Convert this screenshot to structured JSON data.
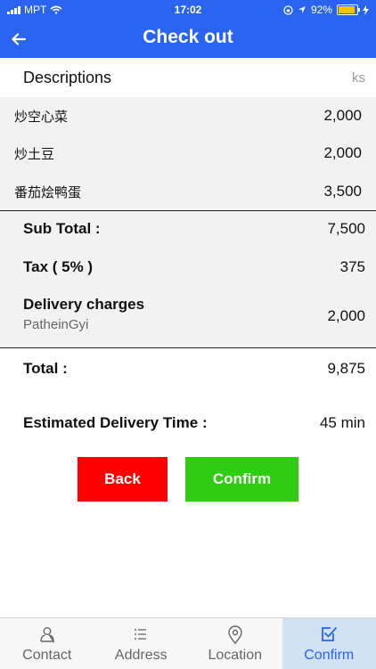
{
  "status_bar": {
    "carrier": "MPT",
    "time": "17:02",
    "battery_percent": "92%",
    "battery_level": 0.92
  },
  "header": {
    "title": "Check out",
    "back_icon": "arrow-left-icon"
  },
  "descriptions": {
    "label": "Descriptions",
    "currency": "ks"
  },
  "items": [
    {
      "name": "炒空心菜",
      "price": "2,000"
    },
    {
      "name": "炒土豆",
      "price": "2,000"
    },
    {
      "name": "番茄烩鸭蛋",
      "price": "3,500"
    }
  ],
  "summary": {
    "subtotal_label": "Sub Total :",
    "subtotal_value": "7,500",
    "tax_label": "Tax ( 5% )",
    "tax_value": "375",
    "delivery_label": "Delivery charges",
    "delivery_location": "PatheinGyi",
    "delivery_value": "2,000"
  },
  "total": {
    "label": "Total :",
    "value": "9,875"
  },
  "eta": {
    "label": "Estimated Delivery Time :",
    "value": "45 min"
  },
  "actions": {
    "back_label": "Back",
    "confirm_label": "Confirm"
  },
  "tabs": [
    {
      "label": "Contact",
      "icon": "person-icon"
    },
    {
      "label": "Address",
      "icon": "list-icon"
    },
    {
      "label": "Location",
      "icon": "map-pin-icon"
    },
    {
      "label": "Confirm",
      "icon": "checkbox-icon",
      "active": true
    }
  ],
  "colors": {
    "primary": "#2b63f1",
    "back_button": "#ff0000",
    "confirm_button": "#2fcc12",
    "active_tab_bg": "#cfe2f6"
  }
}
